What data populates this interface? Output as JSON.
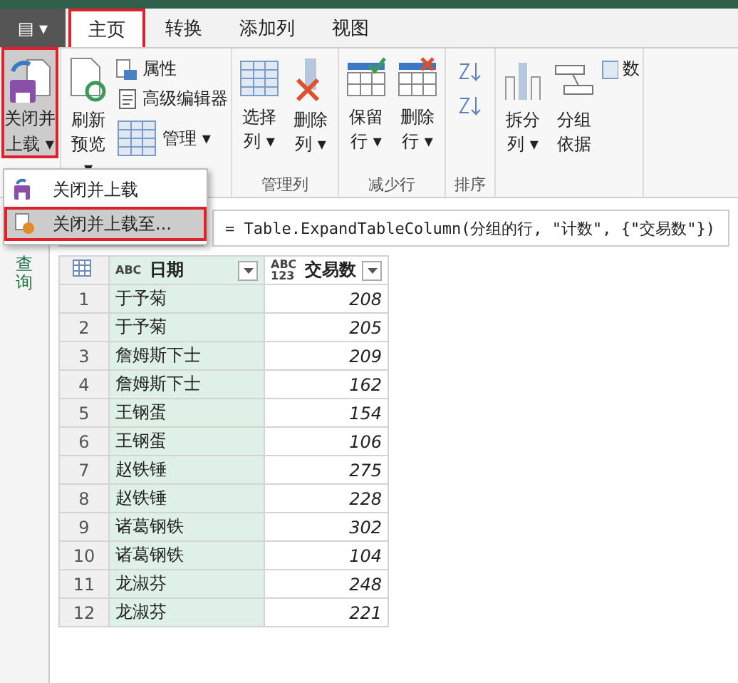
{
  "file_button": {
    "label": "▤ ▾"
  },
  "tabs": [
    {
      "label": "主页",
      "selected": true
    },
    {
      "label": "转换",
      "selected": false
    },
    {
      "label": "添加列",
      "selected": false
    },
    {
      "label": "视图",
      "selected": false
    }
  ],
  "ribbon": {
    "close_load": {
      "line_1": "关闭并",
      "line_2": "上载 ▾",
      "highlighted": true
    },
    "groups": [
      {
        "buttons": [
          {
            "label": "刷新预览 ▾"
          }
        ],
        "small": [
          {
            "label": "属性"
          },
          {
            "label": "高级编辑器"
          },
          {
            "label": "管理 ▾"
          }
        ]
      },
      {
        "label": "管理列",
        "buttons": [
          {
            "label": "选择列 ▾"
          },
          {
            "label": "删除列 ▾"
          }
        ]
      },
      {
        "label": "减少行",
        "buttons": [
          {
            "label": "保留行 ▾"
          },
          {
            "label": "删除行 ▾"
          }
        ]
      },
      {
        "label": "排序"
      },
      {
        "buttons": [
          {
            "label": "拆分列 ▾"
          },
          {
            "label": "分组依据"
          }
        ],
        "small": [
          {
            "label": "数"
          }
        ]
      }
    ]
  },
  "menu": [
    {
      "label": "关闭并上载",
      "highlighted": false
    },
    {
      "label": "关闭并上载至...",
      "highlighted": true
    }
  ],
  "formula": "= Table.ExpandTableColumn(分组的行, \"计数\", {\"交易数\"})",
  "nav_label": "查询",
  "table": {
    "columns": [
      {
        "type": "ABC",
        "label": "日期"
      },
      {
        "type": "ABC 123",
        "label": "交易数"
      }
    ],
    "rows": [
      {
        "number": "1",
        "cells": [
          "于予菊",
          "208"
        ]
      },
      {
        "number": "2",
        "cells": [
          "于予菊",
          "205"
        ]
      },
      {
        "number": "3",
        "cells": [
          "詹姆斯下士",
          "209"
        ]
      },
      {
        "number": "4",
        "cells": [
          "詹姆斯下士",
          "162"
        ]
      },
      {
        "number": "5",
        "cells": [
          "王钢蛋",
          "154"
        ]
      },
      {
        "number": "6",
        "cells": [
          "王钢蛋",
          "106"
        ]
      },
      {
        "number": "7",
        "cells": [
          "赵铁锤",
          "275"
        ]
      },
      {
        "number": "8",
        "cells": [
          "赵铁锤",
          "228"
        ]
      },
      {
        "number": "9",
        "cells": [
          "诸葛钢铁",
          "302"
        ]
      },
      {
        "number": "10",
        "cells": [
          "诸葛钢铁",
          "104"
        ]
      },
      {
        "number": "11",
        "cells": [
          "龙淑芬",
          "248"
        ]
      },
      {
        "number": "12",
        "cells": [
          "龙淑芬",
          "221"
        ]
      }
    ]
  }
}
